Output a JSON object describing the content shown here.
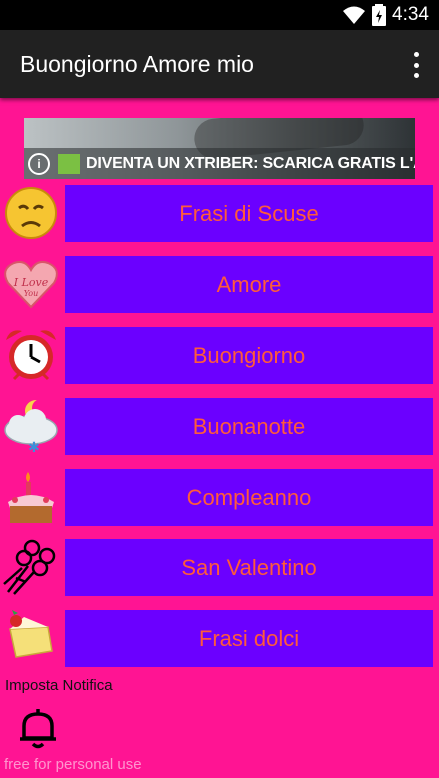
{
  "status_bar": {
    "time": "4:34"
  },
  "app_bar": {
    "title": "Buongiorno Amore mio",
    "menu_icon": "overflow-menu-icon"
  },
  "banner": {
    "text": "DIVENTA UN XTRIBER: SCARICA GRATIS L'APP!",
    "info_icon_glyph": "i"
  },
  "categories": [
    {
      "label": "Frasi di Scuse",
      "icon": "sad-face-icon"
    },
    {
      "label": "Amore",
      "icon": "i-love-you-heart-icon"
    },
    {
      "label": "Buongiorno",
      "icon": "alarm-clock-icon"
    },
    {
      "label": "Buonanotte",
      "icon": "moon-cloud-icon"
    },
    {
      "label": "Compleanno",
      "icon": "birthday-cake-icon"
    },
    {
      "label": "San Valentino",
      "icon": "flower-bouquet-icon"
    },
    {
      "label": "Frasi dolci",
      "icon": "sweet-cake-icon"
    }
  ],
  "notification": {
    "label": "Imposta Notifica",
    "icon": "bell-icon"
  },
  "watermark": "free for personal use",
  "colors": {
    "background": "#ff1493",
    "button": "#6b00ff",
    "button_text": "#ff5b3a",
    "app_bar": "#212121"
  }
}
